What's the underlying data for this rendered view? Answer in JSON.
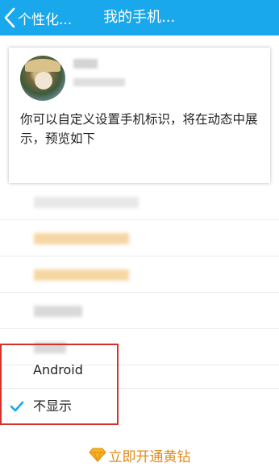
{
  "header": {
    "back_label": "个性化...",
    "title": "我的手机..."
  },
  "card": {
    "description": "你可以自定义设置手机标识，将在动态中展示，预览如下"
  },
  "options": [
    {
      "label": "",
      "blurred": true,
      "selected": false
    },
    {
      "label": "",
      "blurred": true,
      "selected": false
    },
    {
      "label": "",
      "blurred": true,
      "selected": false
    },
    {
      "label": "",
      "blurred": true,
      "selected": false
    },
    {
      "label": "",
      "blurred": true,
      "selected": false
    },
    {
      "label": "Android",
      "blurred": false,
      "selected": false
    },
    {
      "label": "不显示",
      "blurred": false,
      "selected": true
    }
  ],
  "footer": {
    "label": "立即开通黄钻"
  },
  "colors": {
    "header_bg": "#19a8ec",
    "check": "#19a8ec",
    "highlight": "#d8312c",
    "footer_text": "#e28b1a"
  }
}
